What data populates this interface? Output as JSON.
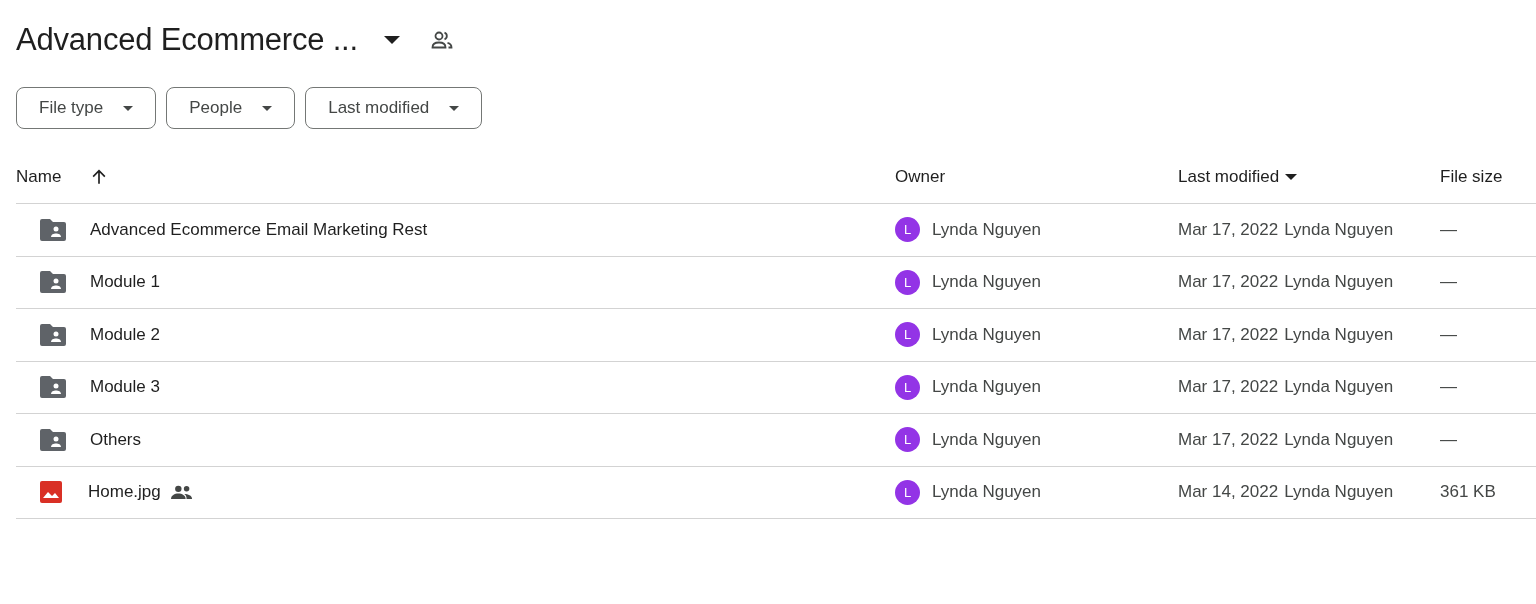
{
  "header": {
    "title": "Advanced Ecommerce ..."
  },
  "filters": [
    {
      "label": "File type"
    },
    {
      "label": "People"
    },
    {
      "label": "Last modified"
    }
  ],
  "table": {
    "columns": [
      {
        "label": "Name",
        "kind": "sort_ascending"
      },
      {
        "label": "Owner",
        "kind": "plain"
      },
      {
        "label": "Last modified",
        "kind": "sort_descending"
      },
      {
        "label": "File size",
        "kind": "plain"
      }
    ],
    "rows": [
      {
        "kind": "folder",
        "name": "Advanced Ecommerce Email Marketing Rest",
        "shared": false,
        "owner_initial": "L",
        "owner": "Lynda Nguyen",
        "modified_date": "Mar 17, 2022",
        "modified_by": "Lynda Nguyen",
        "size": "—"
      },
      {
        "kind": "folder",
        "name": "Module 1",
        "shared": false,
        "owner_initial": "L",
        "owner": "Lynda Nguyen",
        "modified_date": "Mar 17, 2022",
        "modified_by": "Lynda Nguyen",
        "size": "—"
      },
      {
        "kind": "folder",
        "name": "Module 2",
        "shared": false,
        "owner_initial": "L",
        "owner": "Lynda Nguyen",
        "modified_date": "Mar 17, 2022",
        "modified_by": "Lynda Nguyen",
        "size": "—"
      },
      {
        "kind": "folder",
        "name": "Module 3",
        "shared": false,
        "owner_initial": "L",
        "owner": "Lynda Nguyen",
        "modified_date": "Mar 17, 2022",
        "modified_by": "Lynda Nguyen",
        "size": "—"
      },
      {
        "kind": "folder",
        "name": "Others",
        "shared": false,
        "owner_initial": "L",
        "owner": "Lynda Nguyen",
        "modified_date": "Mar 17, 2022",
        "modified_by": "Lynda Nguyen",
        "size": "—"
      },
      {
        "kind": "image",
        "name": "Home.jpg",
        "shared": true,
        "owner_initial": "L",
        "owner": "Lynda Nguyen",
        "modified_date": "Mar 14, 2022",
        "modified_by": "Lynda Nguyen",
        "size": "361 KB"
      }
    ]
  }
}
